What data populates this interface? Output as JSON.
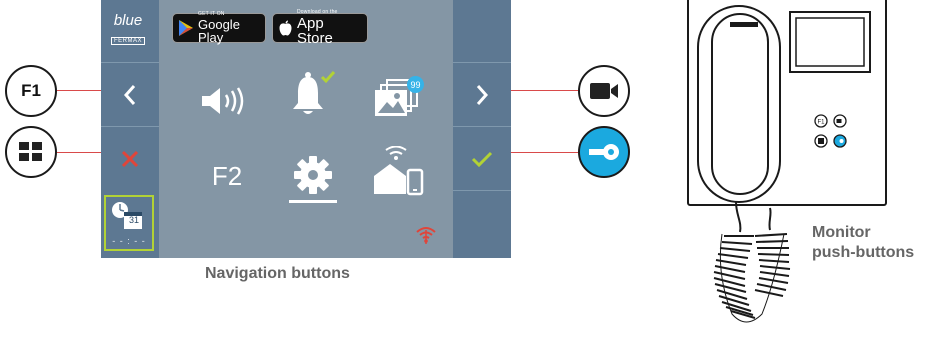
{
  "screen": {
    "logo": {
      "brand": "blue",
      "maker": "FERMAX"
    },
    "stores": {
      "google": {
        "small": "GET IT ON",
        "big": "Google Play"
      },
      "apple": {
        "small": "Download on the",
        "big": "App Store"
      }
    },
    "menu": {
      "row1": [
        "speaker-volume-icon",
        "bell-notification-icon",
        "image-gallery-icon"
      ],
      "row2": [
        "F2",
        "settings-gear-icon",
        "home-phone-connect-icon"
      ],
      "gallery_badge": "99"
    },
    "agenda": {
      "day": "31",
      "time": "- - : - -"
    },
    "left_buttons": [
      "logo",
      "previous-chevron",
      "cancel-x",
      "agenda"
    ],
    "right_buttons": [
      "blank",
      "next-chevron",
      "confirm-check",
      "blank"
    ],
    "wifi_status": "no-connection"
  },
  "external_buttons": {
    "f1": {
      "label": "F1"
    },
    "menu": {
      "icon": "grid-icon"
    },
    "camera": {
      "icon": "camera-icon"
    },
    "key": {
      "icon": "key-icon"
    }
  },
  "captions": {
    "navigation": "Navigation buttons",
    "monitor_line1": "Monitor",
    "monitor_line2": "push-buttons"
  },
  "device": {
    "f1_label": "F1"
  },
  "colors": {
    "screen_bg": "#8496a5",
    "side_bg": "#5d7892",
    "accent_green": "#b2d235",
    "cancel_red": "#e0453a",
    "key_blue": "#1ba9df",
    "connector_red": "#d94a4a",
    "caption_gray": "#666666"
  }
}
